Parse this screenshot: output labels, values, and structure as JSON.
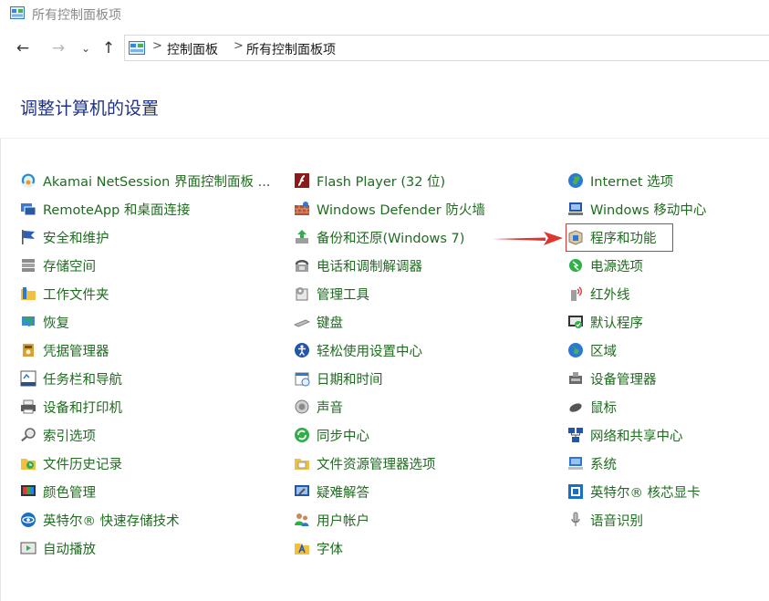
{
  "window": {
    "title": "所有控制面板项",
    "icon": "control-panel-icon"
  },
  "nav": {
    "back_icon": "back-arrow-icon",
    "forward_icon": "forward-arrow-icon",
    "recent_icon": "chevron-down-icon",
    "up_icon": "up-arrow-icon"
  },
  "breadcrumb": {
    "items": [
      "控制面板",
      "所有控制面板项"
    ],
    "separator": ">"
  },
  "heading": "调整计算机的设置",
  "colors": {
    "link": "#1f6b1f",
    "heading": "#1e3287",
    "highlight": "#e0342e"
  },
  "columns": [
    [
      {
        "label": "Akamai NetSession 界面控制面板 ...",
        "icon": "akamai-icon"
      },
      {
        "label": "RemoteApp 和桌面连接",
        "icon": "remoteapp-icon"
      },
      {
        "label": "安全和维护",
        "icon": "flag-icon"
      },
      {
        "label": "存储空间",
        "icon": "storage-icon"
      },
      {
        "label": "工作文件夹",
        "icon": "folder-icon"
      },
      {
        "label": "恢复",
        "icon": "recovery-icon"
      },
      {
        "label": "凭据管理器",
        "icon": "credential-icon"
      },
      {
        "label": "任务栏和导航",
        "icon": "taskbar-icon"
      },
      {
        "label": "设备和打印机",
        "icon": "printer-icon"
      },
      {
        "label": "索引选项",
        "icon": "index-icon"
      },
      {
        "label": "文件历史记录",
        "icon": "file-history-icon"
      },
      {
        "label": "颜色管理",
        "icon": "color-icon"
      },
      {
        "label": "英特尔® 快速存储技术",
        "icon": "intel-rst-icon"
      },
      {
        "label": "自动播放",
        "icon": "autoplay-icon"
      }
    ],
    [
      {
        "label": "Flash Player (32 位)",
        "icon": "flash-icon"
      },
      {
        "label": "Windows Defender 防火墙",
        "icon": "firewall-icon"
      },
      {
        "label": "备份和还原(Windows 7)",
        "icon": "backup-icon"
      },
      {
        "label": "电话和调制解调器",
        "icon": "phone-icon"
      },
      {
        "label": "管理工具",
        "icon": "admin-tools-icon"
      },
      {
        "label": "键盘",
        "icon": "keyboard-icon"
      },
      {
        "label": "轻松使用设置中心",
        "icon": "accessibility-icon"
      },
      {
        "label": "日期和时间",
        "icon": "calendar-icon"
      },
      {
        "label": "声音",
        "icon": "speaker-icon"
      },
      {
        "label": "同步中心",
        "icon": "sync-icon"
      },
      {
        "label": "文件资源管理器选项",
        "icon": "folder-options-icon"
      },
      {
        "label": "疑难解答",
        "icon": "troubleshoot-icon"
      },
      {
        "label": "用户帐户",
        "icon": "users-icon"
      },
      {
        "label": "字体",
        "icon": "font-icon"
      }
    ],
    [
      {
        "label": "Internet 选项",
        "icon": "globe-icon"
      },
      {
        "label": "Windows 移动中心",
        "icon": "mobility-icon"
      },
      {
        "label": "程序和功能",
        "icon": "programs-icon"
      },
      {
        "label": "电源选项",
        "icon": "power-icon"
      },
      {
        "label": "红外线",
        "icon": "infrared-icon"
      },
      {
        "label": "默认程序",
        "icon": "default-programs-icon"
      },
      {
        "label": "区域",
        "icon": "region-icon"
      },
      {
        "label": "设备管理器",
        "icon": "device-manager-icon"
      },
      {
        "label": "鼠标",
        "icon": "mouse-icon"
      },
      {
        "label": "网络和共享中心",
        "icon": "network-icon"
      },
      {
        "label": "系统",
        "icon": "system-icon"
      },
      {
        "label": "英特尔® 核芯显卡",
        "icon": "intel-graphics-icon"
      },
      {
        "label": "语音识别",
        "icon": "microphone-icon"
      }
    ]
  ],
  "annotation": {
    "highlighted_item": "程序和功能",
    "arrow_icon": "red-arrow-icon"
  }
}
